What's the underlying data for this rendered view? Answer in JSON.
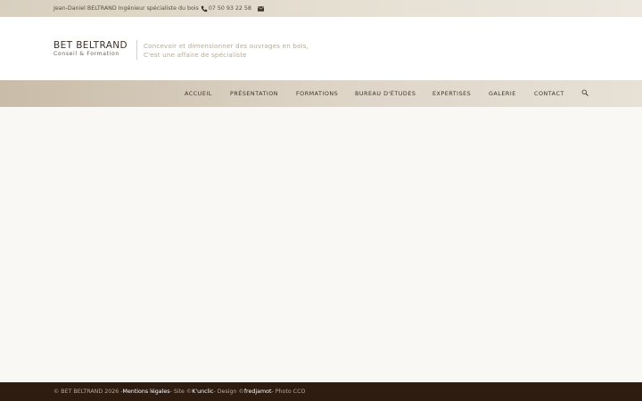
{
  "topbar": {
    "owner_text": "Jean-Daniel BELTRAND Ingénieur spécialiste du bois",
    "phone": "07 50 93 22 58",
    "phone_icon": "phone-icon",
    "mail_icon": "envelope-icon"
  },
  "logo": {
    "title": "BET BELTRAND",
    "subtitle": "Conseil & Formation"
  },
  "tagline": {
    "line1": "Concevoir et dimensionner des ouvrages en bois,",
    "line2": "C'est une affaire de spécialiste"
  },
  "nav": {
    "items": [
      {
        "label": "ACCUEIL"
      },
      {
        "label": "PRÉSENTATION"
      },
      {
        "label": "FORMATIONS"
      },
      {
        "label": "BUREAU D'ÉTUDES"
      },
      {
        "label": "EXPERTISES"
      },
      {
        "label": "GALERIE"
      },
      {
        "label": "CONTACT"
      }
    ],
    "search_icon": "search-icon"
  },
  "footer": {
    "copyright": "© BET BELTRAND 2026 - ",
    "legal_link": "Mentions légales",
    "site_text": " - Site © ",
    "site_link": "K'unclic",
    "design_text": " - Design © ",
    "design_link": "fredjamot",
    "photo_text": " - Photo CCO"
  },
  "colors": {
    "footer_bg": "#2e1c10",
    "nav_bg": "#d8cdbc",
    "page_bg": "#faf8f4"
  }
}
